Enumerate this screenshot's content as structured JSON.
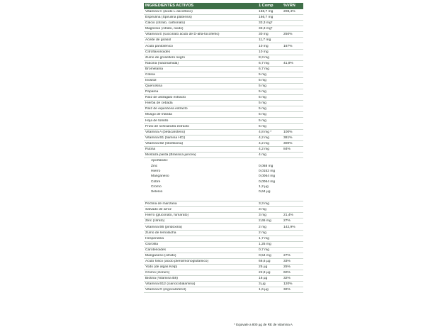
{
  "table": {
    "headers": [
      "INGREDIENTES ACTIVOS",
      "1 Comp",
      "%VRN"
    ],
    "rows": [
      {
        "name": "Vitamina C (ácido L-ascórbico)",
        "amount": "166,7 mg",
        "vrn": "208,4%"
      },
      {
        "name": "Espirulina (Spirulina platensis)",
        "amount": "166,7 mg",
        "vrn": ""
      },
      {
        "name": "Calcio (citrato, carbonato)",
        "amount": "33,3 mg*",
        "vrn": ""
      },
      {
        "name": "Magnesio (citrato, óxido)",
        "amount": "33,3 mg*",
        "vrn": ""
      },
      {
        "name": "Vitamina E (succinato ácido de D-alfa-tocoferilo)",
        "amount": "30 mg",
        "vrn": "250%"
      },
      {
        "name": "Aceite de girasol",
        "amount": "11,7 mg",
        "vrn": ""
      },
      {
        "name": "Ácido pantoténico",
        "amount": "10 mg",
        "vrn": "167%"
      },
      {
        "name": "Citroflavonoides",
        "amount": "10 mg",
        "vrn": ""
      },
      {
        "name": "Zumo de grosellero negro",
        "amount": "8,3 mg",
        "vrn": ""
      },
      {
        "name": "Niacina (niacinamida)",
        "amount": "6,7 mg",
        "vrn": "41,9%"
      },
      {
        "name": "Bromelaína",
        "amount": "6,7 mg",
        "vrn": ""
      },
      {
        "name": "Colina",
        "amount": "5 mg",
        "vrn": ""
      },
      {
        "name": "Inositol",
        "amount": "5 mg",
        "vrn": ""
      },
      {
        "name": "Quercetina",
        "amount": "5 mg",
        "vrn": ""
      },
      {
        "name": "Papaína",
        "amount": "5 mg",
        "vrn": ""
      },
      {
        "name": "Raíz de astrágalo extracto",
        "amount": "5 mg",
        "vrn": ""
      },
      {
        "name": "Hierba de cebada",
        "amount": "5 mg",
        "vrn": ""
      },
      {
        "name": "Raíz de equinácea extracto",
        "amount": "5 mg",
        "vrn": ""
      },
      {
        "name": "Musgo de Irlanda",
        "amount": "5 mg",
        "vrn": ""
      },
      {
        "name": "Hoja de tomillo",
        "amount": "5 mg",
        "vrn": ""
      },
      {
        "name": "Fruto de schisandra extracto",
        "amount": "5 mg",
        "vrn": ""
      },
      {
        "name": "Vitamina A (betacaroteno)",
        "amount": "4,8 mg *",
        "vrn": "100%"
      },
      {
        "name": "Vitamina B1 (tiamina HCl)",
        "amount": "4,2 mg",
        "vrn": "381%"
      },
      {
        "name": "Vitamina  B2 (riboflavina)",
        "amount": "4,2 mg",
        "vrn": "300%"
      },
      {
        "name": "Rutina",
        "amount": "4,2 mg",
        "vrn": "84%"
      },
      {
        "name": "Mostaza parda (Brassica juncea)",
        "amount": "4 mg",
        "vrn": ""
      }
    ],
    "sub_heading": "Aportando:",
    "sub_rows": [
      {
        "name": "Zinc",
        "amount": "0,068 mg"
      },
      {
        "name": "Hierro",
        "amount": "0,0152 mg"
      },
      {
        "name": "Manganeso",
        "amount": "0,0064 mg"
      },
      {
        "name": "Cobre",
        "amount": "0,0064 mg"
      },
      {
        "name": "Cromo",
        "amount": "1,2 µg"
      },
      {
        "name": "Selenio",
        "amount": "0,64 µg"
      }
    ],
    "rows2": [
      {
        "name": "Pectina de manzana",
        "amount": "3,3 mg",
        "vrn": ""
      },
      {
        "name": "Salvado de arroz",
        "amount": "3 mg",
        "vrn": ""
      },
      {
        "name": "Hierro (gluconato, fumarato)",
        "amount": "3 mg",
        "vrn": "21,4%"
      },
      {
        "name": "Zinc (citrato)",
        "amount": "2,65 mg",
        "vrn": "27%"
      },
      {
        "name": "Vitamina B6 (piridoxina)",
        "amount": "2 mg",
        "vrn": "142,9%"
      },
      {
        "name": "Zumo de remolacha",
        "amount": "2 mg",
        "vrn": ""
      },
      {
        "name": "Hesperidina",
        "amount": "1,7 mg",
        "vrn": ""
      },
      {
        "name": "Clorofila",
        "amount": "1,25 mg",
        "vrn": ""
      },
      {
        "name": "Carotenoides",
        "amount": "0,7 mg",
        "vrn": ""
      },
      {
        "name": "Manganeso (citrato)",
        "amount": "0,54 mg",
        "vrn": "27%"
      },
      {
        "name": "Ácido fólico (ácido pteroilmonoglutámico)",
        "amount": "66,6 µg",
        "vrn": "33%"
      },
      {
        "name": "Yodo (de algas Kelp)",
        "amount": "25 µg",
        "vrn": "25%"
      },
      {
        "name": "Cromo (cloruro)",
        "amount": "22,8 µg",
        "vrn": "60%"
      },
      {
        "name": "Biotina (Vitamina B8)",
        "amount": "16 µg",
        "vrn": "32%"
      },
      {
        "name": "Vitamina B12 (cianocobalamina)",
        "amount": "3 µg",
        "vrn": "120%"
      },
      {
        "name": "Vitamina D (ergocalciferol)",
        "amount": "1,6 µg",
        "vrn": "32%"
      }
    ]
  },
  "footnote": "* Equivale a 800 µg de RE de vitamina A",
  "colors": {
    "header_bg": "#3f6f48",
    "header_text": "#ffffff",
    "rule": "#c9d4cc"
  }
}
